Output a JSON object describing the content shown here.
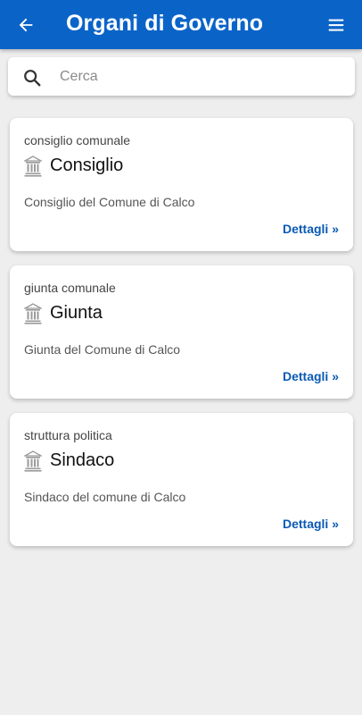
{
  "header": {
    "title": "Organi di Governo",
    "back_icon": "arrow-left-icon",
    "menu_icon": "hamburger-menu-icon",
    "color": "#0a64c8"
  },
  "search": {
    "placeholder": "Cerca",
    "value": "",
    "icon": "search-icon"
  },
  "cards": [
    {
      "category": "consiglio comunale",
      "icon": "building-icon",
      "name": "Consiglio",
      "description": "Consiglio del Comune di Calco",
      "link": "Dettagli »"
    },
    {
      "category": "giunta comunale",
      "icon": "building-icon",
      "name": "Giunta",
      "description": "Giunta del Comune di Calco",
      "link": "Dettagli »"
    },
    {
      "category": "struttura politica",
      "icon": "building-icon",
      "name": "Sindaco",
      "description": "Sindaco del comune di Calco",
      "link": "Dettagli »"
    }
  ],
  "colors": {
    "accent": "#0a64c8",
    "link": "#0a5ab4",
    "background": "#eeeeee"
  }
}
